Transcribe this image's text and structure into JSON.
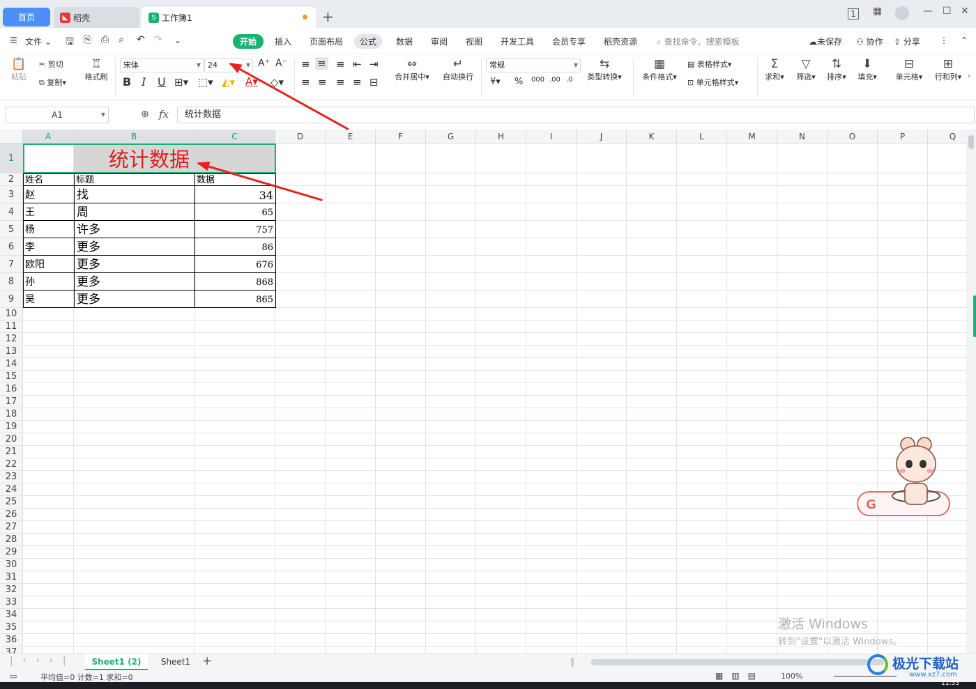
{
  "tabs": {
    "home": "首页",
    "daoke": "稻壳",
    "workbook": "工作簿1"
  },
  "menu": {
    "file": "文件",
    "items": [
      "开始",
      "插入",
      "页面布局",
      "公式",
      "数据",
      "审阅",
      "视图",
      "开发工具",
      "会员专享",
      "稻壳资源"
    ],
    "search": "查找命令、搜索模板",
    "unsaved": "未保存",
    "collab": "协作",
    "share": "分享"
  },
  "ribbon": {
    "paste": "粘贴",
    "cut": "剪切",
    "copy": "复制",
    "format_painter": "格式刷",
    "font_name": "宋体",
    "font_size": "24",
    "merge_center": "合并居中",
    "wrap_text": "自动换行",
    "number_format": "常规",
    "type_convert": "类型转换",
    "cond_format": "条件格式",
    "table_style": "表格样式",
    "cell_style": "单元格样式",
    "sum": "求和",
    "filter": "筛选",
    "sort": "排序",
    "fill": "填充",
    "cell": "单元格",
    "row_col": "行和列"
  },
  "formula_bar": {
    "name_box": "A1",
    "fx": "fx",
    "value": "统计数据"
  },
  "columns": [
    "A",
    "B",
    "C",
    "D",
    "E",
    "F",
    "G",
    "H",
    "I",
    "J",
    "K",
    "L",
    "M",
    "N",
    "O",
    "P",
    "Q"
  ],
  "sheet": {
    "title": "统计数据",
    "headers": [
      "姓名",
      "标题",
      "数据"
    ],
    "rows": [
      [
        "赵",
        "找",
        "34"
      ],
      [
        "王",
        "周",
        "65"
      ],
      [
        "杨",
        "许多",
        "757"
      ],
      [
        "李",
        "更多",
        "86"
      ],
      [
        "欧阳",
        "更多",
        "676"
      ],
      [
        "孙",
        "更多",
        "868"
      ],
      [
        "吴",
        "更多",
        "865"
      ]
    ]
  },
  "sheet_tabs": [
    "Sheet1 (2)",
    "Sheet1"
  ],
  "status": {
    "text": "平均值=0  计数=1  求和=0",
    "zoom": "100%"
  },
  "watermark": {
    "line1": "激活 Windows",
    "line2": "转到\"设置\"以激活 Windows。"
  },
  "site_logo": "极光下载站",
  "site_url": "www.xz7.com",
  "clock": "11:53",
  "colors": {
    "accent_green": "#1ab270",
    "title_red": "#d9211e",
    "arrow_red": "#e8231b"
  }
}
